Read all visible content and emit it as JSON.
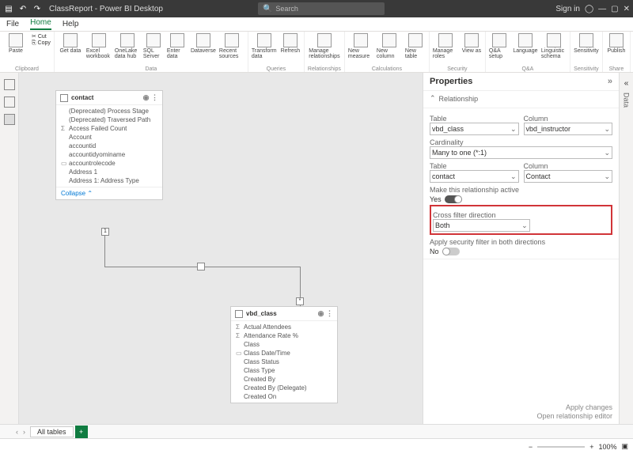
{
  "titlebar": {
    "title": "ClassReport - Power BI Desktop",
    "search": "Search",
    "signin": "Sign in"
  },
  "menubar": {
    "file": "File",
    "home": "Home",
    "help": "Help"
  },
  "ribbon": {
    "clipboard": {
      "paste": "Paste",
      "cut": "Cut",
      "copy": "Copy",
      "label": "Clipboard"
    },
    "data": {
      "get": "Get data",
      "excel": "Excel workbook",
      "onelake": "OneLake data hub",
      "sql": "SQL Server",
      "enter": "Enter data",
      "dataverse": "Dataverse",
      "recent": "Recent sources",
      "label": "Data"
    },
    "queries": {
      "transform": "Transform data",
      "refresh": "Refresh",
      "label": "Queries"
    },
    "relationships": {
      "manage": "Manage relationships",
      "label": "Relationships"
    },
    "calculations": {
      "measure": "New measure",
      "column": "New column",
      "table": "New table",
      "label": "Calculations"
    },
    "security": {
      "roles": "Manage roles",
      "viewas": "View as",
      "label": "Security"
    },
    "qa": {
      "qasetup": "Q&A setup",
      "language": "Language",
      "schema": "Linguistic schema",
      "label": "Q&A"
    },
    "sensitivity": {
      "sens": "Sensitivity",
      "label": "Sensitivity"
    },
    "share": {
      "publish": "Publish",
      "label": "Share"
    }
  },
  "contact_card": {
    "name": "contact",
    "fields": [
      "(Deprecated) Process Stage",
      "(Deprecated) Traversed Path",
      "Access Failed Count",
      "Account",
      "accountid",
      "accountidyominame",
      "accountrolecode",
      "Address 1",
      "Address 1: Address Type"
    ],
    "collapse": "Collapse ⌃"
  },
  "class_card": {
    "name": "vbd_class",
    "fields": [
      "Actual Attendees",
      "Attendance Rate %",
      "Class",
      "Class Date/Time",
      "Class Status",
      "Class Type",
      "Created By",
      "Created By (Delegate)",
      "Created On"
    ]
  },
  "props": {
    "title": "Properties",
    "section": "Relationship",
    "table_lbl": "Table",
    "column_lbl": "Column",
    "table1": "vbd_class",
    "column1": "vbd_instructor",
    "cardinality_lbl": "Cardinality",
    "cardinality": "Many to one (*:1)",
    "table2": "contact",
    "column2": "Contact",
    "active_lbl": "Make this relationship active",
    "active_val": "Yes",
    "crossfilter_lbl": "Cross filter direction",
    "crossfilter": "Both",
    "security_lbl": "Apply security filter in both directions",
    "security_val": "No",
    "apply": "Apply changes",
    "editor": "Open relationship editor"
  },
  "tabbar": {
    "alltables": "All tables"
  },
  "rightrail": {
    "data": "Data"
  },
  "footer": {
    "zoom": "100%"
  }
}
